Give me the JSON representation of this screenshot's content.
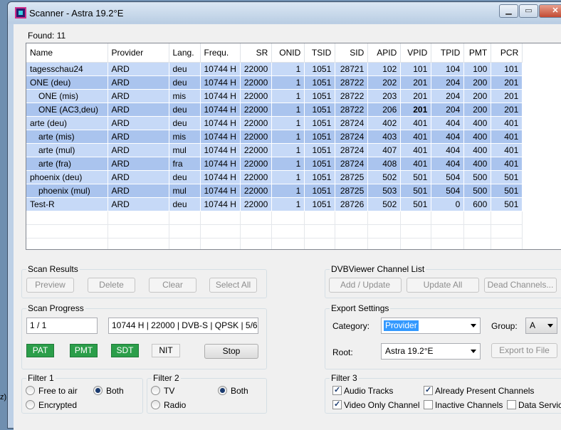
{
  "window": {
    "title": "Scanner - Astra 19.2°E"
  },
  "found": {
    "label": "Found:",
    "count": "11"
  },
  "table": {
    "columns": [
      "Name",
      "Provider",
      "Lang.",
      "Frequ.",
      "SR",
      "ONID",
      "TSID",
      "SID",
      "APID",
      "VPID",
      "TPID",
      "PMT",
      "PCR"
    ],
    "rows": [
      {
        "name": "tagesschau24",
        "child": false,
        "cells": [
          "ARD",
          "deu",
          "10744 H",
          "22000",
          "1",
          "1051",
          "28721",
          "102",
          "101",
          "104",
          "100",
          "101"
        ]
      },
      {
        "name": "ONE (deu)",
        "child": false,
        "cells": [
          "ARD",
          "deu",
          "10744 H",
          "22000",
          "1",
          "1051",
          "28722",
          "202",
          "201",
          "204",
          "200",
          "201"
        ]
      },
      {
        "name": "ONE (mis)",
        "child": true,
        "cells": [
          "ARD",
          "mis",
          "10744 H",
          "22000",
          "1",
          "1051",
          "28722",
          "203",
          "201",
          "204",
          "200",
          "201"
        ]
      },
      {
        "name": "ONE (AC3,deu)",
        "child": true,
        "cells": [
          "ARD",
          "deu",
          "10744 H",
          "22000",
          "1",
          "1051",
          "28722",
          "206",
          "201",
          "204",
          "200",
          "201"
        ],
        "bold_col": 8
      },
      {
        "name": "arte (deu)",
        "child": false,
        "cells": [
          "ARD",
          "deu",
          "10744 H",
          "22000",
          "1",
          "1051",
          "28724",
          "402",
          "401",
          "404",
          "400",
          "401"
        ]
      },
      {
        "name": "arte (mis)",
        "child": true,
        "cells": [
          "ARD",
          "mis",
          "10744 H",
          "22000",
          "1",
          "1051",
          "28724",
          "403",
          "401",
          "404",
          "400",
          "401"
        ]
      },
      {
        "name": "arte (mul)",
        "child": true,
        "cells": [
          "ARD",
          "mul",
          "10744 H",
          "22000",
          "1",
          "1051",
          "28724",
          "407",
          "401",
          "404",
          "400",
          "401"
        ]
      },
      {
        "name": "arte (fra)",
        "child": true,
        "cells": [
          "ARD",
          "fra",
          "10744 H",
          "22000",
          "1",
          "1051",
          "28724",
          "408",
          "401",
          "404",
          "400",
          "401"
        ]
      },
      {
        "name": "phoenix (deu)",
        "child": false,
        "cells": [
          "ARD",
          "deu",
          "10744 H",
          "22000",
          "1",
          "1051",
          "28725",
          "502",
          "501",
          "504",
          "500",
          "501"
        ]
      },
      {
        "name": "phoenix (mul)",
        "child": true,
        "cells": [
          "ARD",
          "mul",
          "10744 H",
          "22000",
          "1",
          "1051",
          "28725",
          "503",
          "501",
          "504",
          "500",
          "501"
        ]
      },
      {
        "name": "Test-R",
        "child": false,
        "cells": [
          "ARD",
          "deu",
          "10744 H",
          "22000",
          "1",
          "1051",
          "28726",
          "502",
          "501",
          "0",
          "600",
          "501"
        ]
      }
    ]
  },
  "scan_results": {
    "title": "Scan Results",
    "preview": "Preview",
    "delete": "Delete",
    "clear": "Clear",
    "select_all": "Select All"
  },
  "dvbviewer": {
    "title": "DVBViewer Channel List",
    "add_update": "Add / Update",
    "update_all": "Update All",
    "dead_channels": "Dead Channels..."
  },
  "scan_progress": {
    "title": "Scan Progress",
    "counter": "1 / 1",
    "transponder": "10744 H | 22000 | DVB-S | QPSK | 5/6",
    "pat": "PAT",
    "pmt": "PMT",
    "sdt": "SDT",
    "nit": "NIT",
    "stop": "Stop"
  },
  "export": {
    "title": "Export Settings",
    "category_label": "Category:",
    "category_value": "Provider",
    "group_label": "Group:",
    "group_value": "A",
    "root_label": "Root:",
    "root_value": "Astra 19.2°E",
    "export_to_file": "Export to File"
  },
  "filter1": {
    "title": "Filter 1",
    "free_to_air": "Free to air",
    "both": "Both",
    "encrypted": "Encrypted"
  },
  "filter2": {
    "title": "Filter 2",
    "tv": "TV",
    "both": "Both",
    "radio": "Radio"
  },
  "filter3": {
    "title": "Filter 3",
    "audio_tracks": "Audio Tracks",
    "already_present": "Already Present Channels",
    "video_only": "Video Only Channel",
    "inactive": "Inactive Channels",
    "data_services": "Data Services"
  },
  "background": {
    "snippet": "z)"
  }
}
